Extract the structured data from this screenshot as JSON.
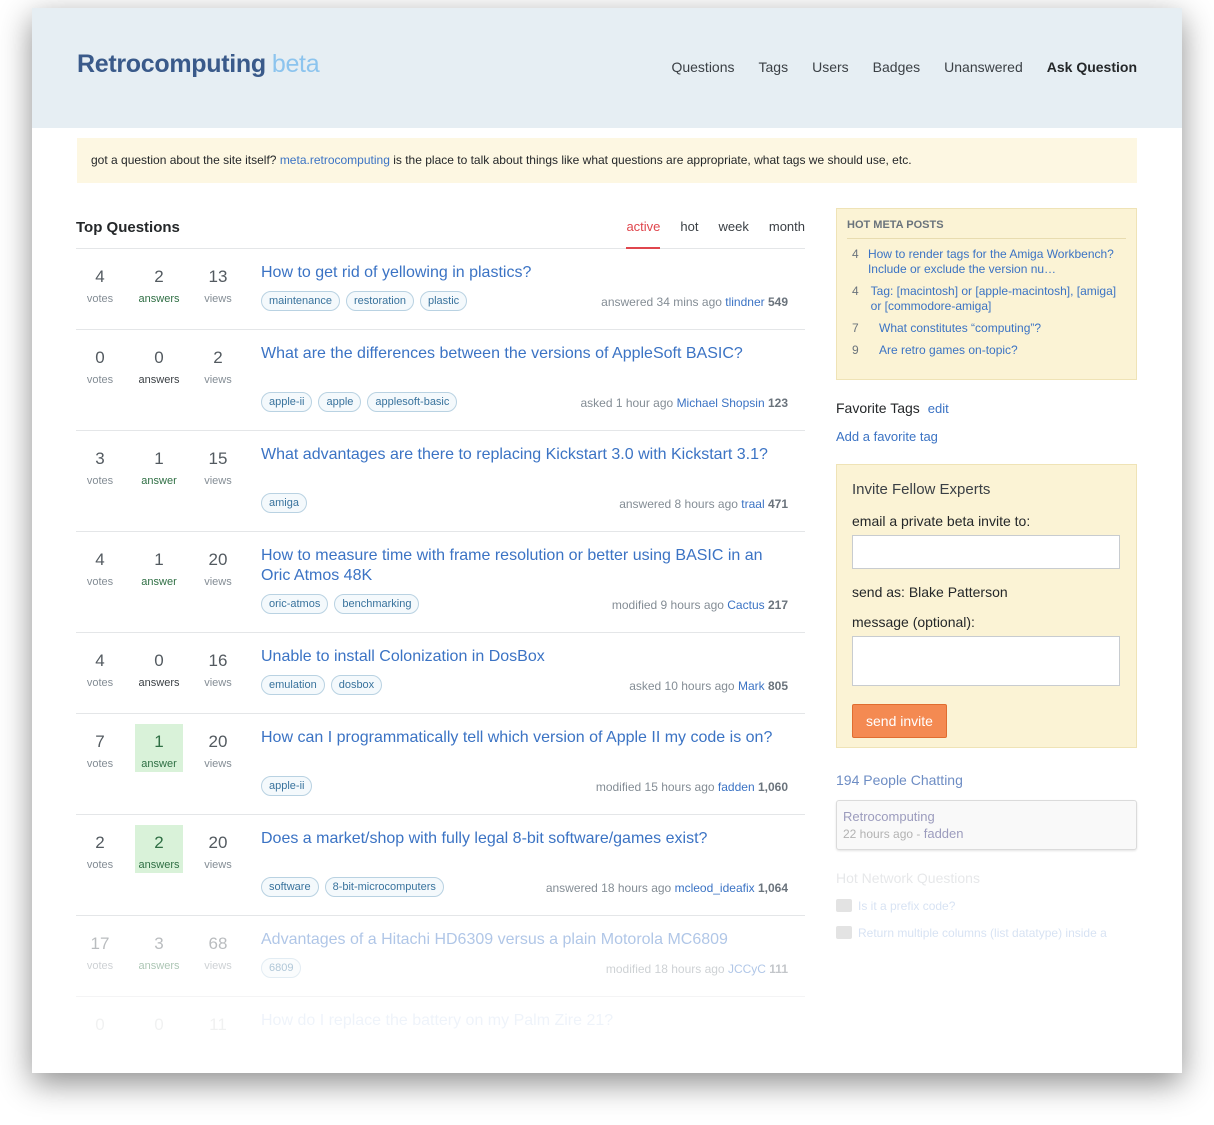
{
  "header": {
    "site": "Retrocomputing",
    "beta": "beta",
    "nav": [
      "Questions",
      "Tags",
      "Users",
      "Badges",
      "Unanswered"
    ],
    "ask": "Ask Question"
  },
  "notice": {
    "before": "got a question about the site itself?",
    "link": "meta.retrocomputing",
    "after": "is the place to talk about things like what questions are appropriate, what tags we should use, etc."
  },
  "main": {
    "title": "Top Questions",
    "tabs": [
      "active",
      "hot",
      "week",
      "month"
    ],
    "active_tab": "active",
    "questions": [
      {
        "votes": "4",
        "votes_l": "votes",
        "answers": "2",
        "answers_l": "answers",
        "views": "13",
        "views_l": "views",
        "title": "How to get rid of yellowing in plastics?",
        "tags": [
          "maintenance",
          "restoration",
          "plastic"
        ],
        "action": "answered 34 mins ago",
        "user": "tlindner",
        "rep": "549",
        "accepted": false
      },
      {
        "votes": "0",
        "votes_l": "votes",
        "answers": "0",
        "answers_l": "answers",
        "views": "2",
        "views_l": "views",
        "title": "What are the differences between the versions of AppleSoft BASIC?",
        "tags": [
          "apple-ii",
          "apple",
          "applesoft-basic"
        ],
        "action": "asked 1 hour ago",
        "user": "Michael Shopsin",
        "rep": "123",
        "accepted": false
      },
      {
        "votes": "3",
        "votes_l": "votes",
        "answers": "1",
        "answers_l": "answer",
        "views": "15",
        "views_l": "views",
        "title": "What advantages are there to replacing Kickstart 3.0 with Kickstart 3.1?",
        "tags": [
          "amiga"
        ],
        "action": "answered 8 hours ago",
        "user": "traal",
        "rep": "471",
        "accepted": false
      },
      {
        "votes": "4",
        "votes_l": "votes",
        "answers": "1",
        "answers_l": "answer",
        "views": "20",
        "views_l": "views",
        "title": "How to measure time with frame resolution or better using BASIC in an Oric Atmos 48K",
        "tags": [
          "oric-atmos",
          "benchmarking"
        ],
        "action": "modified 9 hours ago",
        "user": "Cactus",
        "rep": "217",
        "accepted": false
      },
      {
        "votes": "4",
        "votes_l": "votes",
        "answers": "0",
        "answers_l": "answers",
        "views": "16",
        "views_l": "views",
        "title": "Unable to install Colonization in DosBox",
        "tags": [
          "emulation",
          "dosbox"
        ],
        "action": "asked 10 hours ago",
        "user": "Mark",
        "rep": "805",
        "accepted": false
      },
      {
        "votes": "7",
        "votes_l": "votes",
        "answers": "1",
        "answers_l": "answer",
        "views": "20",
        "views_l": "views",
        "title": "How can I programmatically tell which version of Apple II my code is on?",
        "tags": [
          "apple-ii"
        ],
        "action": "modified 15 hours ago",
        "user": "fadden",
        "rep": "1,060",
        "accepted": true
      },
      {
        "votes": "2",
        "votes_l": "votes",
        "answers": "2",
        "answers_l": "answers",
        "views": "20",
        "views_l": "views",
        "title": "Does a market/shop with fully legal 8-bit software/games exist?",
        "tags": [
          "software",
          "8-bit-microcomputers"
        ],
        "action": "answered 18 hours ago",
        "user": "mcleod_ideafix",
        "rep": "1,064",
        "accepted": true
      },
      {
        "votes": "17",
        "votes_l": "votes",
        "answers": "3",
        "answers_l": "answers",
        "views": "68",
        "views_l": "views",
        "title": "Advantages of a Hitachi HD6309 versus a plain Motorola MC6809",
        "tags": [
          "6809"
        ],
        "action": "modified 18 hours ago",
        "user": "JCCyC",
        "rep": "111",
        "accepted": false
      },
      {
        "votes": "0",
        "votes_l": "",
        "answers": "0",
        "answers_l": "",
        "views": "11",
        "views_l": "",
        "title": "How do I replace the battery on my Palm Zire 21?",
        "tags": [],
        "action": "",
        "user": "",
        "rep": "",
        "accepted": false
      }
    ]
  },
  "sidebar": {
    "hot_meta": {
      "title": "HOT META POSTS",
      "items": [
        {
          "count": "4",
          "title": "How to render tags for the Amiga Workbench? Include or exclude the version nu…"
        },
        {
          "count": "4",
          "title": "Tag: [macintosh] or [apple-macintosh], [amiga] or [commodore-amiga]"
        },
        {
          "count": "7",
          "title": "What constitutes “computing”?"
        },
        {
          "count": "9",
          "title": "Are retro games on-topic?"
        }
      ]
    },
    "favorite": {
      "title": "Favorite Tags",
      "edit": "edit",
      "add": "Add a favorite tag"
    },
    "invite": {
      "title": "Invite Fellow Experts",
      "email_label": "email a private beta invite to:",
      "email_value": "",
      "send_as": "send as: Blake Patterson",
      "message_label": "message (optional):",
      "message_value": "",
      "button": "send invite"
    },
    "chat": {
      "title": "194 People Chatting",
      "room": "Retrocomputing",
      "time": "22 hours ago -",
      "user": "fadden"
    },
    "hot_network": {
      "title": "Hot Network Questions",
      "items": [
        "Is it a prefix code?",
        "Return multiple columns (list datatype) inside a"
      ]
    }
  },
  "colors": {
    "link": "#3b73c4",
    "accent": "#e0464d",
    "accepted": "#d9f2d9",
    "button": "#f48a52",
    "header_bg": "#e6eef3",
    "notice_bg": "#fdf7e2"
  }
}
